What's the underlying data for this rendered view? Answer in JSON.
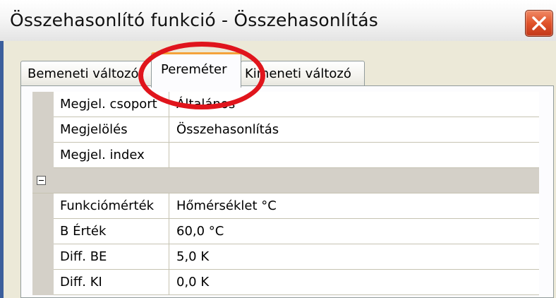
{
  "window": {
    "title": "Összehasonlító funkció - Összehasonlítás"
  },
  "tabs": [
    {
      "label": "Bemeneti változó",
      "active": false
    },
    {
      "label": "Pereméter",
      "active": true
    },
    {
      "label": "Kimeneti változó",
      "active": false
    }
  ],
  "properties": {
    "rows": [
      {
        "key": "Megjel. csoport",
        "value": "Általános"
      },
      {
        "key": "Megjelölés",
        "value": "Összehasonlítás"
      },
      {
        "key": "Megjel. index",
        "value": ""
      }
    ],
    "category_rows": [
      {
        "key": "Funkciómérték",
        "value": "Hőmérséklet °C"
      },
      {
        "key": "B Érték",
        "value": "60,0 °C"
      },
      {
        "key": "Diff. BE",
        "value": "5,0 K"
      },
      {
        "key": "Diff. KI",
        "value": "0,0 K"
      }
    ]
  },
  "colors": {
    "highlight": "#e0151c",
    "active_tab_accent": "#f4a23a",
    "close_button": "#e0532a"
  },
  "icons": {
    "close": "close-icon",
    "collapse": "collapse-minus-icon"
  }
}
